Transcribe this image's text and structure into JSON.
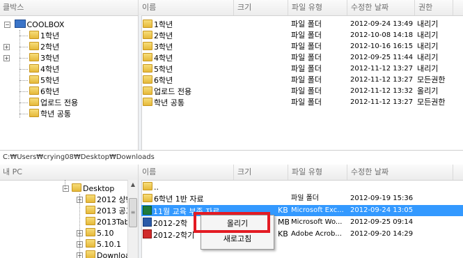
{
  "top_left": {
    "header": "클박스",
    "tree": {
      "root": "COOLBOX",
      "children": [
        "1학년",
        "2학년",
        "3학년",
        "4학년",
        "5학년",
        "6학년",
        "업로드 전용",
        "학년 공통"
      ]
    }
  },
  "top_right": {
    "columns": [
      "이름",
      "크기",
      "파일 유형",
      "수정한 날짜",
      "권한"
    ],
    "rows": [
      {
        "name": "1학년",
        "size": "",
        "type": "파일 폴더",
        "date": "2012-09-24 13:49",
        "perm": "내리기"
      },
      {
        "name": "2학년",
        "size": "",
        "type": "파일 폴더",
        "date": "2012-10-08 14:18",
        "perm": "내리기"
      },
      {
        "name": "3학년",
        "size": "",
        "type": "파일 폴더",
        "date": "2012-10-16 16:15",
        "perm": "내리기"
      },
      {
        "name": "4학년",
        "size": "",
        "type": "파일 폴더",
        "date": "2012-09-25 11:44",
        "perm": "내리기"
      },
      {
        "name": "5학년",
        "size": "",
        "type": "파일 폴더",
        "date": "2012-11-12 13:27",
        "perm": "내리기"
      },
      {
        "name": "6학년",
        "size": "",
        "type": "파일 폴더",
        "date": "2012-11-12 13:27",
        "perm": "모든권한"
      },
      {
        "name": "업로드 전용",
        "size": "",
        "type": "파일 폴더",
        "date": "2012-11-12 13:32",
        "perm": "올리기"
      },
      {
        "name": "학년 공통",
        "size": "",
        "type": "파일 폴더",
        "date": "2012-11-12 13:27",
        "perm": "모든권한"
      }
    ]
  },
  "path_bar": "C:₩Users₩crying08₩Desktop₩Downloads",
  "bottom_left": {
    "header": "내 PC",
    "tree": [
      "Desktop",
      "2012 상반",
      "2013 공고",
      "2013Tabl",
      "5.10",
      "5.10.1",
      "Downloa"
    ]
  },
  "bottom_right": {
    "columns": [
      "이름",
      "크기",
      "파일 유형",
      "수정한 날짜"
    ],
    "rows": [
      {
        "name": "..",
        "size": "",
        "type": "",
        "date": ""
      },
      {
        "name": "6학년 1반 자료",
        "size": "",
        "type": "파일 폴더",
        "date": "2012-09-19 15:36"
      },
      {
        "name": "11월 교육 부족 자료",
        "size": "KB",
        "type": "Microsoft Exc...",
        "date": "2012-09-24 13:05",
        "selected": true
      },
      {
        "name": "2012-2학",
        "size": "MB",
        "type": "Microsoft Wo...",
        "date": "2012-09-25 09:14"
      },
      {
        "name": "2012-2학기",
        "size": "KB",
        "type": "Adobe Acrob...",
        "date": "2012-09-20 14:29"
      }
    ]
  },
  "context_menu": {
    "items": [
      "올리기",
      "새로고침"
    ]
  },
  "colors": {
    "selection": "#3399ff",
    "highlight_border": "#e31b23",
    "folder": "#f0c94c"
  }
}
